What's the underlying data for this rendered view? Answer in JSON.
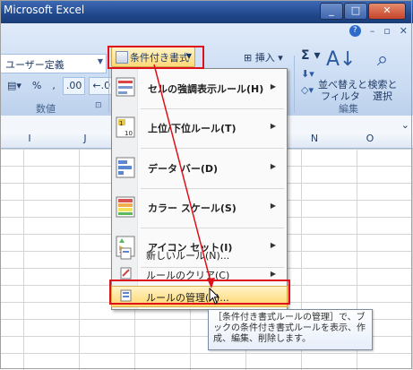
{
  "window": {
    "title": "Microsoft Excel",
    "min_glyph": "_",
    "max_glyph": "□",
    "close_glyph": "✕"
  },
  "ribbon": {
    "top_icons": [
      "?",
      "–",
      "▫",
      "✕"
    ],
    "number_format": "ユーザー定義",
    "number_buttons": [
      "%",
      ",",
      ".00",
      "←.0"
    ],
    "number_group_label": "数値",
    "conditional_format_label": "条件付き書式",
    "insert_label": "挿入",
    "sort_filter_label": "並べ替えと\nフィルタ",
    "find_select_label": "検索と\n選択",
    "edit_group_label": "編集"
  },
  "columns": [
    "I",
    "J",
    "N",
    "O"
  ],
  "menu": {
    "items": [
      {
        "label": "セルの強調表示ルール(H)",
        "submenu": true,
        "icon": "highlight-rules-icon"
      },
      {
        "label": "上位/下位ルール(T)",
        "submenu": true,
        "icon": "top-bottom-rules-icon"
      },
      {
        "label": "データ バー(D)",
        "submenu": true,
        "icon": "data-bars-icon"
      },
      {
        "label": "カラー スケール(S)",
        "submenu": true,
        "icon": "color-scales-icon"
      },
      {
        "label": "アイコン セット(I)",
        "submenu": true,
        "icon": "icon-sets-icon"
      }
    ],
    "small_items": [
      {
        "label": "新しいルール(N)...",
        "submenu": false,
        "icon": "new-rule-icon"
      },
      {
        "label": "ルールのクリア(C)",
        "submenu": true,
        "icon": "clear-rules-icon"
      },
      {
        "label": "ルールの管理(R)...",
        "submenu": false,
        "icon": "manage-rules-icon",
        "highlighted": true
      }
    ]
  },
  "tooltip": "［条件付き書式ルールの管理］で、ブックの条件付き書式ルールを表示、作成、編集、削除します。",
  "colors": {
    "annotation_red": "#e0101a",
    "highlight": "#ffd76e"
  }
}
